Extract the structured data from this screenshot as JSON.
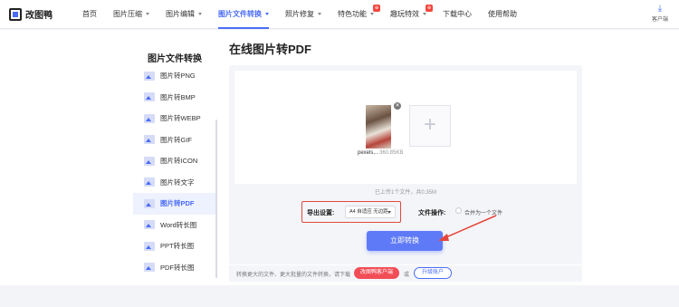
{
  "app": {
    "name": "改图鸭"
  },
  "nav": [
    {
      "label": "首页"
    },
    {
      "label": "图片压缩",
      "caret": true
    },
    {
      "label": "图片编辑",
      "caret": true
    },
    {
      "label": "图片文件转换",
      "caret": true,
      "active": true
    },
    {
      "label": "照片修复",
      "caret": true
    },
    {
      "label": "特色功能",
      "caret": true,
      "badge": "⊕"
    },
    {
      "label": "趣玩特效",
      "caret": true,
      "badge": "⊕"
    },
    {
      "label": "下载中心"
    },
    {
      "label": "使用帮助"
    }
  ],
  "client": {
    "label": "客户端"
  },
  "sidebar": {
    "title": "图片文件转换",
    "items": [
      {
        "label": "图片转PNG"
      },
      {
        "label": "图片转BMP"
      },
      {
        "label": "图片转WEBP"
      },
      {
        "label": "图片转GIF"
      },
      {
        "label": "图片转ICON"
      },
      {
        "label": "图片转文字"
      },
      {
        "label": "图片转PDF",
        "active": true
      },
      {
        "label": "Word转长图"
      },
      {
        "label": "PPT转长图"
      },
      {
        "label": "PDF转长图"
      }
    ]
  },
  "main": {
    "title": "在线图片转PDF",
    "file": {
      "name": "pexels...",
      "size": "360.85KB"
    },
    "upload_info": "已上传1个文件，共0.35M",
    "export_label": "导出设置:",
    "export_value": "A4 自适应 无边距",
    "fileop_label": "文件操作:",
    "merge_label": "合并为一个文件",
    "convert_label": "立即转换"
  },
  "footer": {
    "text": "转换更大的文件、更大批量的文件转换，请下载",
    "vip_button": "改图鸭客户端",
    "or": "或",
    "upgrade_button": "升级账户"
  },
  "colors": {
    "accent": "#4a6cf7",
    "highlight": "#e3473c",
    "vip": "#f24d57"
  }
}
